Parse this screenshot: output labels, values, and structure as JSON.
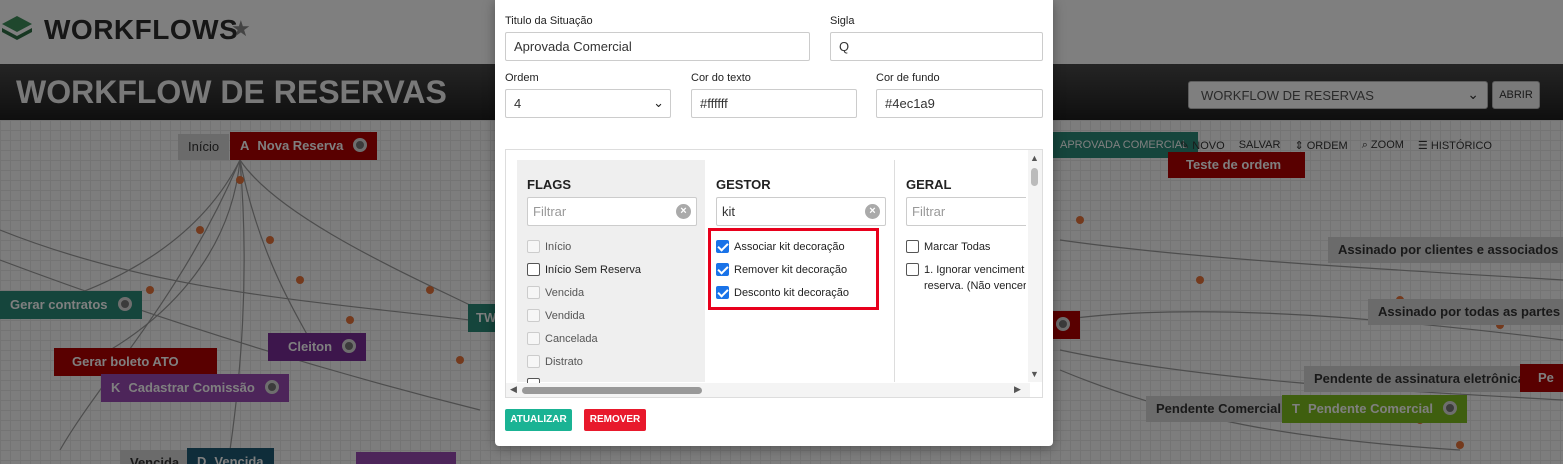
{
  "app": {
    "title": "WORKFLOWS"
  },
  "workflow": {
    "title": "WORKFLOW DE RESERVAS",
    "selected": "WORKFLOW DE RESERVAS",
    "open_label": "ABRIR"
  },
  "toolbar": {
    "new": "NOVO",
    "save": "SALVAR",
    "order": "ORDEM",
    "zoom": "ZOOM",
    "history": "HISTÓRICO"
  },
  "nodes": [
    {
      "text": "Início",
      "letter": "",
      "color": "#d9d9d9"
    },
    {
      "text": "Nova Reserva",
      "letter": "A",
      "color": "#b20000"
    },
    {
      "text": "Gerar contratos",
      "letter": "",
      "color": "#2a8a78"
    },
    {
      "text": "Gerar boleto ATO",
      "letter": "",
      "color": "#b20000"
    },
    {
      "text": "Cleiton",
      "letter": "",
      "color": "#7a2d98"
    },
    {
      "text": "Cadastrar Comissão",
      "letter": "K",
      "color": "#9b4bb5"
    },
    {
      "text": "Vencida",
      "letter": "",
      "color": "#d9d9d9"
    },
    {
      "text": "Vencida",
      "letter": "D",
      "color": "#1e5a75"
    },
    {
      "text": "APROVADA COMERCIAL",
      "letter": "",
      "color": "#2a8a78"
    },
    {
      "text": "Teste de ordem",
      "letter": "",
      "color": "#b20000"
    },
    {
      "text": "Assinado por clientes e associados",
      "letter": "",
      "color": "#d9d9d9"
    },
    {
      "text": "Assinado por todas as partes",
      "letter": "",
      "color": "#d9d9d9"
    },
    {
      "text": "Pendente de assinatura eletrônica",
      "letter": "",
      "color": "#d9d9d9"
    },
    {
      "text": "Pendente Comercial",
      "letter": "",
      "color": "#d9d9d9"
    },
    {
      "text": "Pendente Comercial",
      "letter": "T",
      "color": "#7fbf1f"
    }
  ],
  "form": {
    "titulo_label": "Titulo da Situação",
    "titulo_value": "Aprovada Comercial",
    "sigla_label": "Sigla",
    "sigla_value": "Q",
    "ordem_label": "Ordem",
    "ordem_value": "4",
    "cor_texto_label": "Cor do texto",
    "cor_texto_value": "#ffffff",
    "cor_fundo_label": "Cor de fundo",
    "cor_fundo_value": "#4ec1a9"
  },
  "flags": {
    "title": "FLAGS",
    "filter_placeholder": "Filtrar",
    "items": [
      {
        "label": "Início",
        "checked": false,
        "disabled": true
      },
      {
        "label": "Início Sem Reserva",
        "checked": false,
        "disabled": false
      },
      {
        "label": "Vencida",
        "checked": false,
        "disabled": true
      },
      {
        "label": "Vendida",
        "checked": false,
        "disabled": true
      },
      {
        "label": "Cancelada",
        "checked": false,
        "disabled": true
      },
      {
        "label": "Distrato",
        "checked": false,
        "disabled": true
      }
    ]
  },
  "gestor": {
    "title": "GESTOR",
    "filter_value": "kit",
    "items": [
      {
        "label": "Associar kit decoração",
        "checked": true
      },
      {
        "label": "Remover kit decoração",
        "checked": true
      },
      {
        "label": "Desconto kit decoração",
        "checked": true
      }
    ]
  },
  "geral": {
    "title": "GERAL",
    "filter_placeholder": "Filtrar",
    "items": [
      {
        "label": "Marcar Todas",
        "checked": false
      },
      {
        "label": "1. Ignorar venciment",
        "label2": "reserva. (Não vencer",
        "checked": false
      }
    ]
  },
  "buttons": {
    "update": "ATUALIZAR",
    "remove": "REMOVER"
  },
  "colors": {
    "update": "#1ab394",
    "remove": "#e8192c",
    "highlight": "#e8001c",
    "checkbox": "#1a73e8"
  }
}
